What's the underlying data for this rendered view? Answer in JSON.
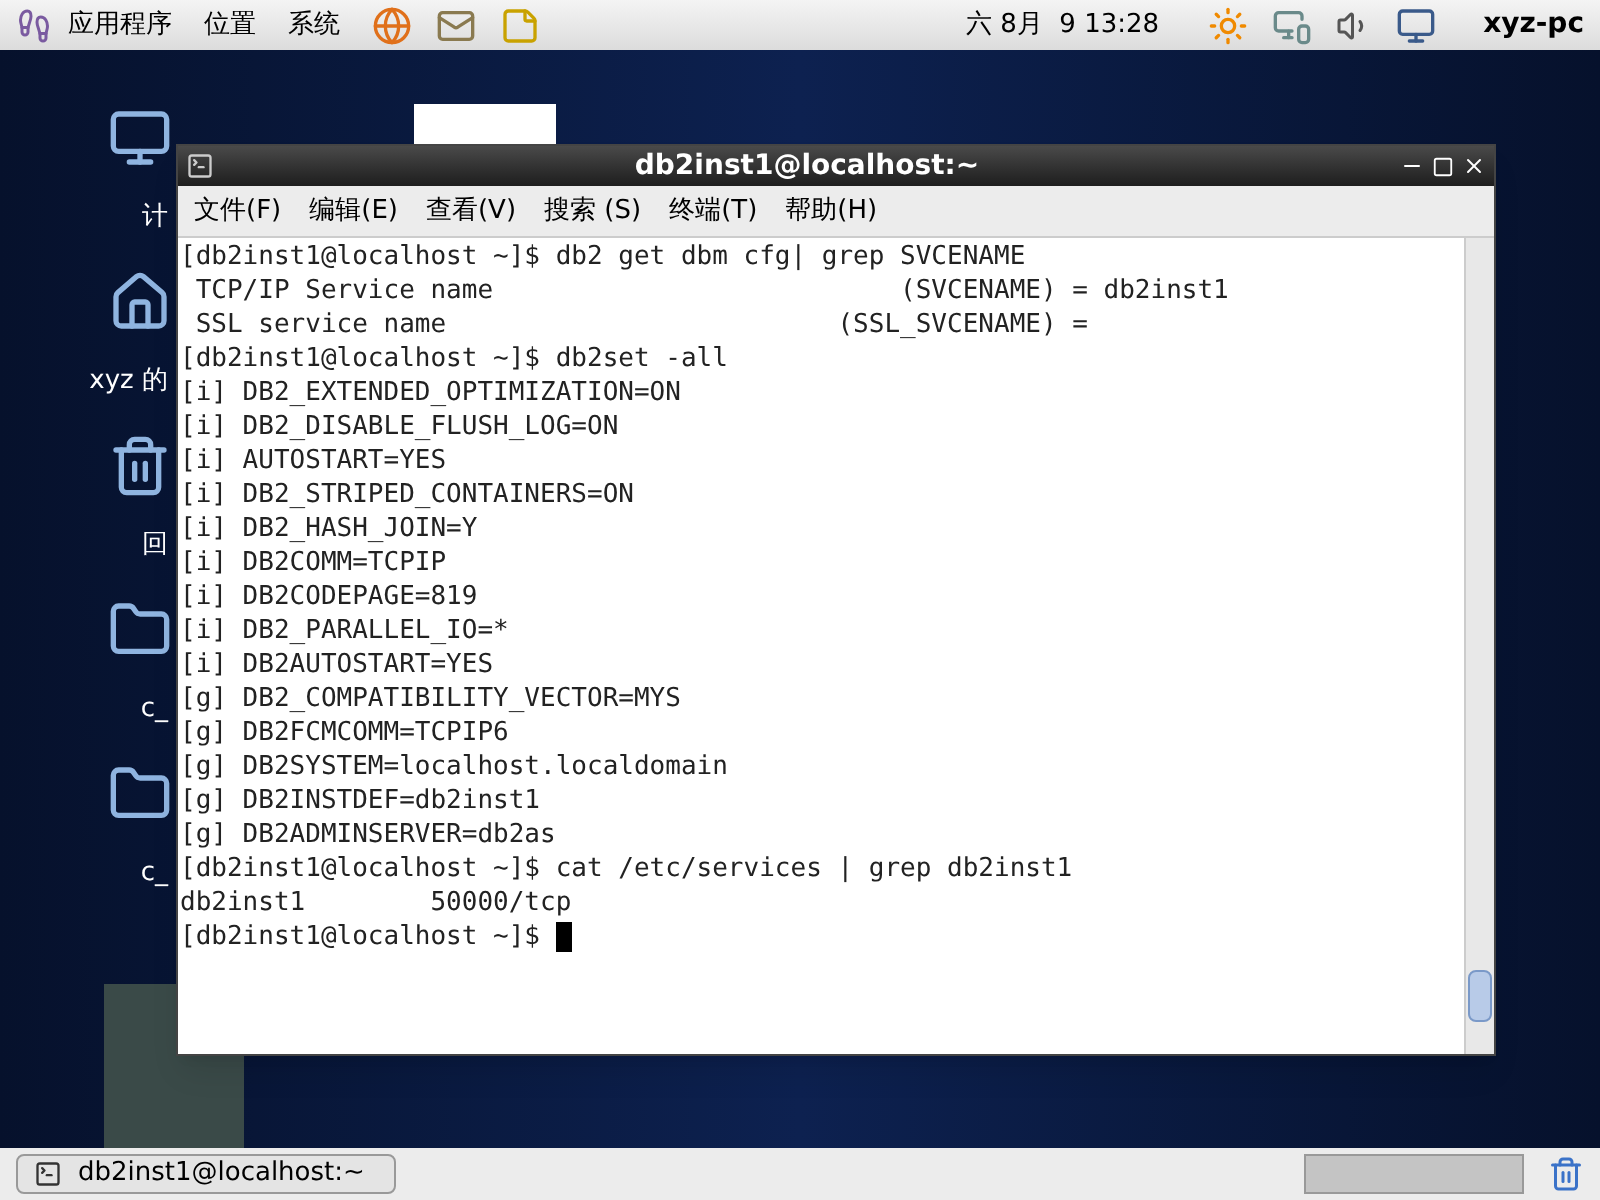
{
  "top_panel": {
    "menus": [
      "应用程序",
      "位置",
      "系统"
    ],
    "clock": "六 8月  9 13:28",
    "user": "xyz-pc"
  },
  "desktop_icons": [
    {
      "kind": "computer",
      "label": "计"
    },
    {
      "kind": "home",
      "label": "xyz 的"
    },
    {
      "kind": "trash",
      "label": "回"
    },
    {
      "kind": "folder",
      "label": "c_"
    },
    {
      "kind": "folder",
      "label": "c_"
    }
  ],
  "terminal": {
    "title": "db2inst1@localhost:~",
    "menu": [
      "文件(F)",
      "编辑(E)",
      "查看(V)",
      "搜索 (S)",
      "终端(T)",
      "帮助(H)"
    ],
    "lines": [
      "[db2inst1@localhost ~]$ db2 get dbm cfg| grep SVCENAME",
      " TCP/IP Service name                          (SVCENAME) = db2inst1",
      " SSL service name                         (SSL_SVCENAME) =",
      "[db2inst1@localhost ~]$ db2set -all",
      "[i] DB2_EXTENDED_OPTIMIZATION=ON",
      "[i] DB2_DISABLE_FLUSH_LOG=ON",
      "[i] AUTOSTART=YES",
      "[i] DB2_STRIPED_CONTAINERS=ON",
      "[i] DB2_HASH_JOIN=Y",
      "[i] DB2COMM=TCPIP",
      "[i] DB2CODEPAGE=819",
      "[i] DB2_PARALLEL_IO=*",
      "[i] DB2AUTOSTART=YES",
      "[g] DB2_COMPATIBILITY_VECTOR=MYS",
      "[g] DB2FCMCOMM=TCPIP6",
      "[g] DB2SYSTEM=localhost.localdomain",
      "[g] DB2INSTDEF=db2inst1",
      "[g] DB2ADMINSERVER=db2as",
      "[db2inst1@localhost ~]$ cat /etc/services | grep db2inst1",
      "db2inst1        50000/tcp",
      "[db2inst1@localhost ~]$ "
    ]
  },
  "taskbar": {
    "windows": [
      {
        "label": "db2inst1@localhost:~",
        "selected": false
      }
    ]
  }
}
